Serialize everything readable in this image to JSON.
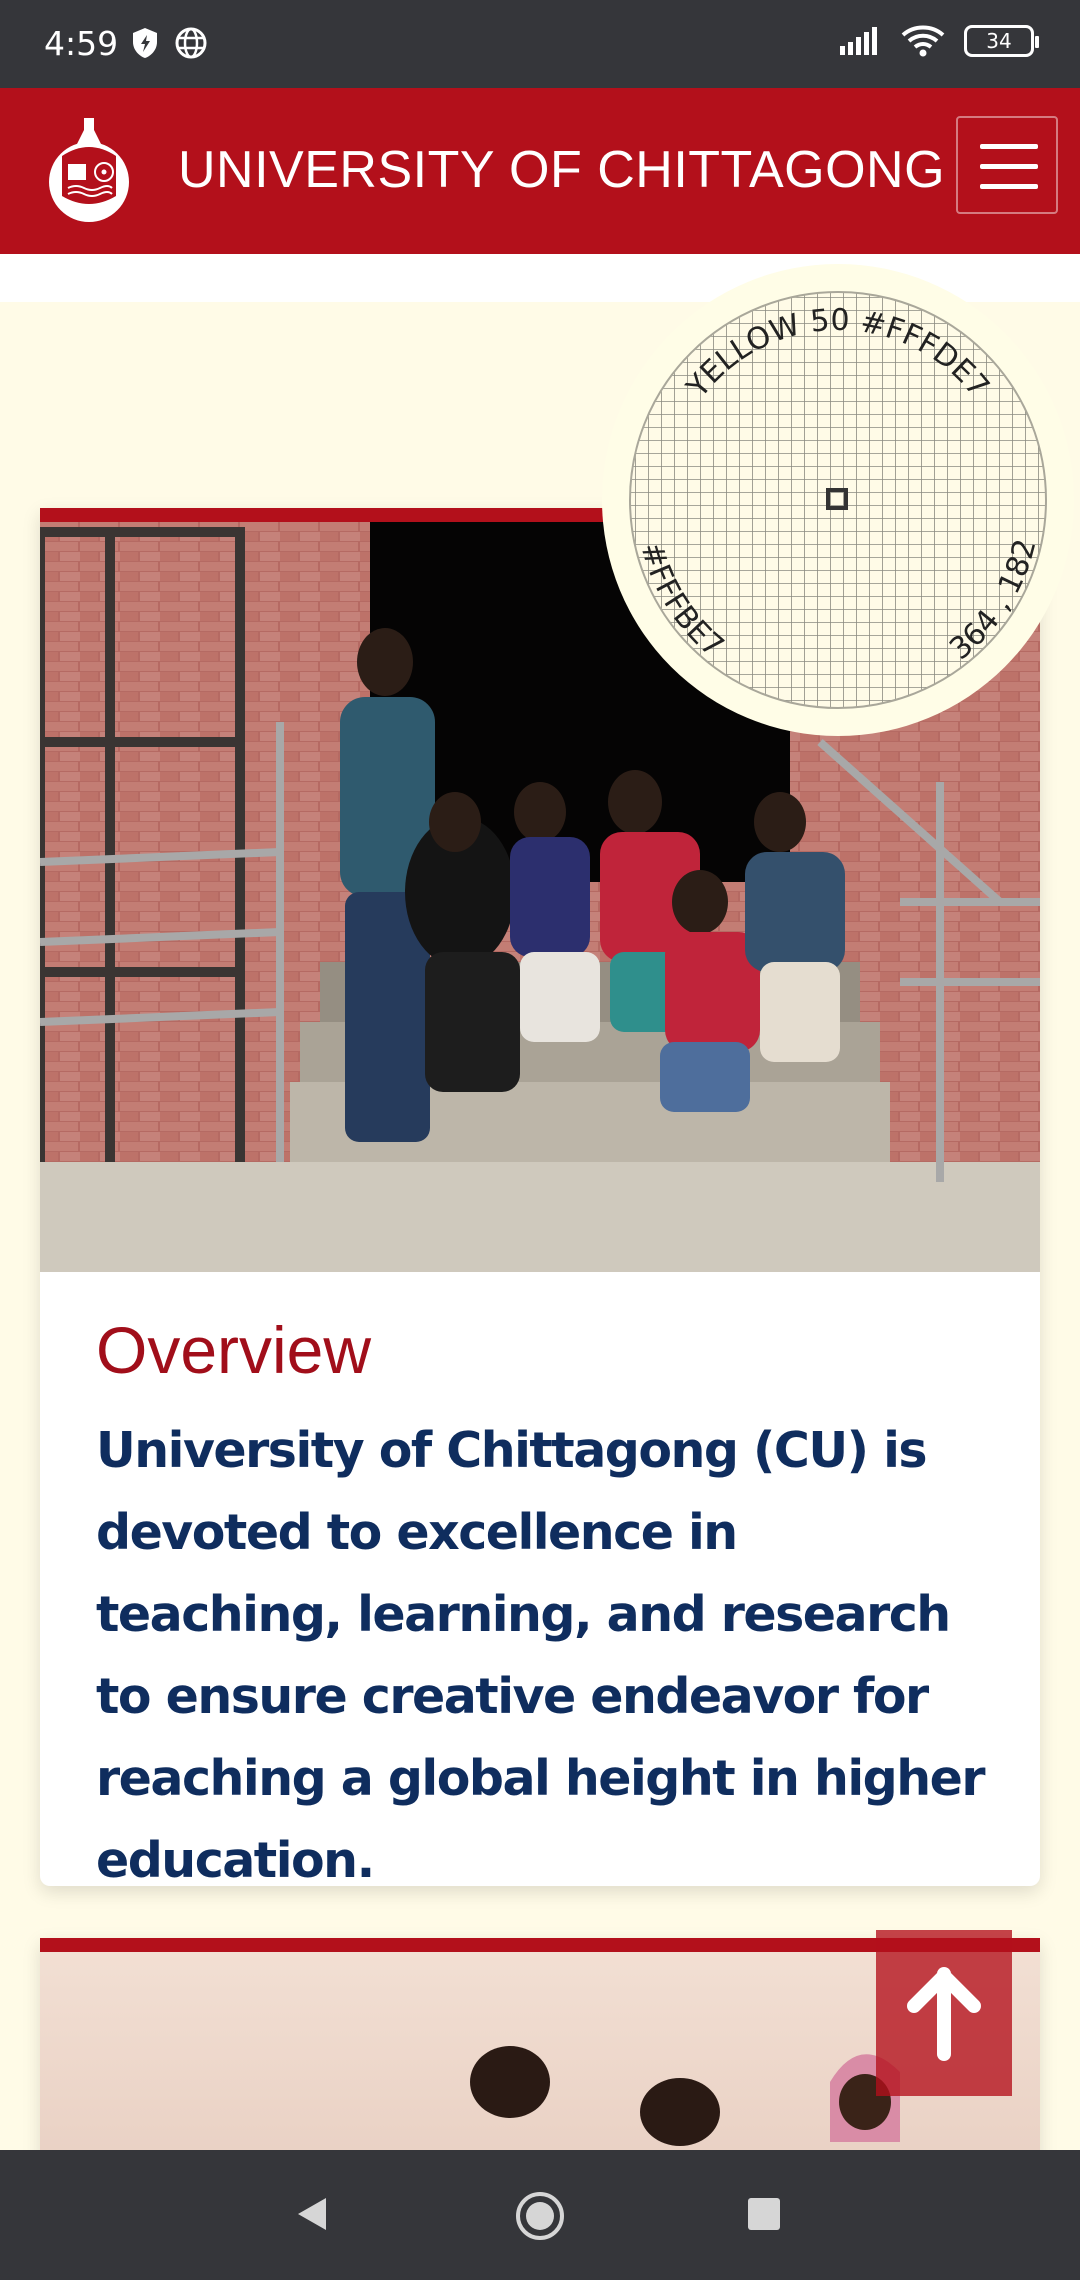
{
  "status_bar": {
    "time": "4:59",
    "battery": "34",
    "icons": [
      "shield-icon",
      "globe-icon",
      "signal-icon",
      "wifi-icon",
      "battery-icon"
    ]
  },
  "header": {
    "title": "UNIVERSITY OF CHITTAGONG",
    "logo_alt": "University of Chittagong logo",
    "menu_icon": "hamburger-icon"
  },
  "colors": {
    "brand": "#b3101b",
    "text_navy": "#0f2d5e",
    "page_bg": "#fffbe7",
    "system_bar": "#35363a"
  },
  "color_picker": {
    "top_label": "YELLOW 50   #FFFDE7",
    "bottom_left": "#FFFBE7",
    "bottom_right": "364 , 182"
  },
  "overview_card": {
    "title": "Overview",
    "body": "University of Chittagong (CU) is devoted to excellence in teaching, learning, and research to ensure creative endeavor for reaching a global height in higher education.",
    "image": "students-on-stairs-photo"
  },
  "second_card": {
    "image": "students-studying-photo"
  },
  "scroll_top": {
    "icon": "arrow-up-icon"
  },
  "nav_bar": {
    "icons": [
      "back-icon",
      "home-icon",
      "recents-icon"
    ]
  }
}
